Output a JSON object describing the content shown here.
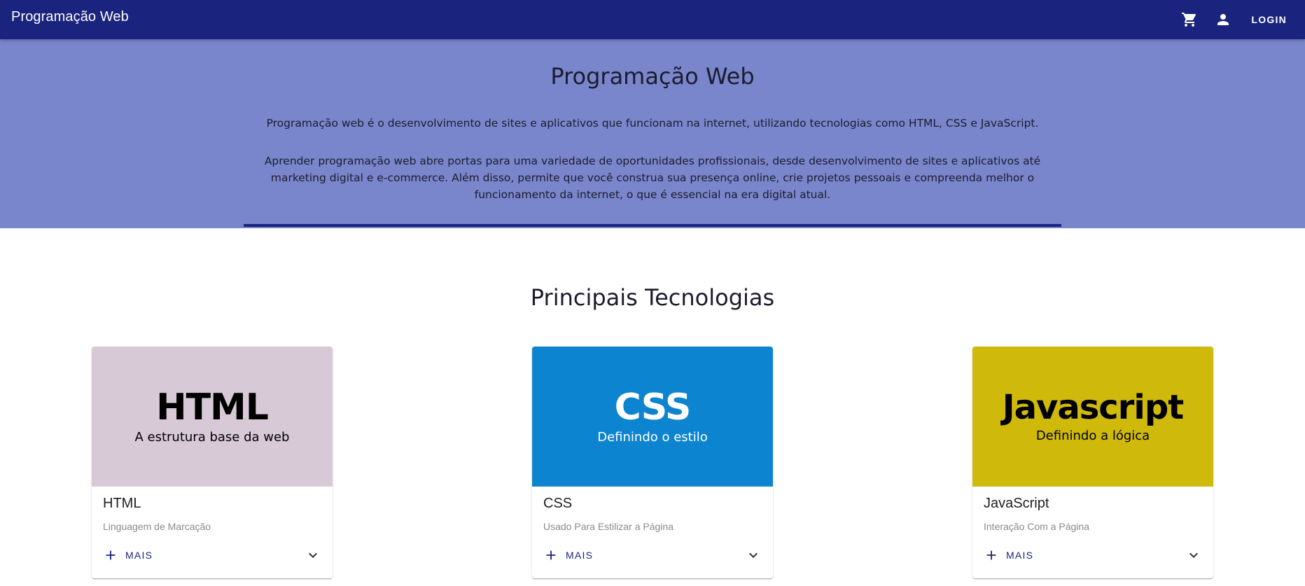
{
  "appbar": {
    "title": "Programação Web",
    "cart_icon": "shopping-cart-icon",
    "user_icon": "person-icon",
    "login_label": "LOGIN"
  },
  "hero": {
    "title": "Programação Web",
    "paragraph1": "Programação web é o desenvolvimento de sites e aplicativos que funcionam na internet, utilizando tecnologias como HTML, CSS e JavaScript.",
    "paragraph2": "Aprender programação web abre portas para uma variedade de oportunidades profissionais, desde desenvolvimento de sites e aplicativos até marketing digital e e-commerce. Além disso, permite que você construa sua presença online, crie projetos pessoais e compreenda melhor o funcionamento da internet, o que é essencial na era digital atual."
  },
  "section": {
    "title": "Principais Tecnologias"
  },
  "colors": {
    "primary": "#1a237e",
    "hero_bg": "#7986cb",
    "html_bg": "#d8c9d6",
    "css_bg": "#0d84cf",
    "js_bg": "#cfb90b"
  },
  "cards": [
    {
      "media_title": "HTML",
      "media_subtitle": "A estrutura base da web",
      "title": "HTML",
      "subtitle": "Linguagem de Marcação",
      "more_label": "MAIS"
    },
    {
      "media_title": "CSS",
      "media_subtitle": "Definindo o estilo",
      "title": "CSS",
      "subtitle": "Usado Para Estilizar a Página",
      "more_label": "MAIS"
    },
    {
      "media_title": "Javascript",
      "media_subtitle": "Definindo a lógica",
      "title": "JavaScript",
      "subtitle": "Interação Com a Página",
      "more_label": "MAIS"
    }
  ]
}
